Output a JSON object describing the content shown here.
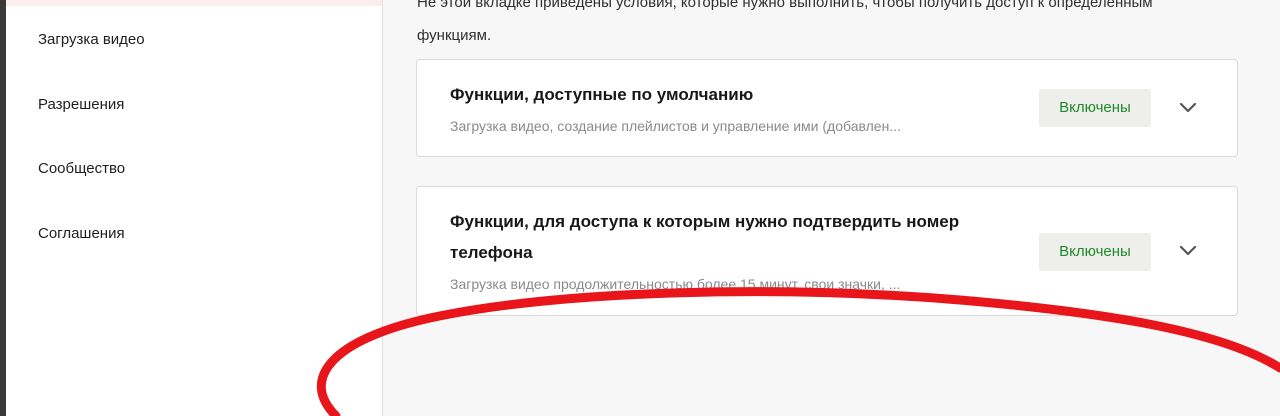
{
  "sidebar": {
    "items": [
      {
        "label": "Загрузка видео"
      },
      {
        "label": "Разрешения"
      },
      {
        "label": "Сообщество"
      },
      {
        "label": "Соглашения"
      }
    ]
  },
  "main": {
    "intro_text": "Не этой вкладке приведены условия, которые нужно выполнить, чтобы получить доступ к определенным функциям.",
    "cards": [
      {
        "title": "Функции, доступные по умолчанию",
        "description": "Загрузка видео, создание плейлистов и управление ими (добавлен...",
        "status": "Включены",
        "toggle_icon": "chevron-down-icon"
      },
      {
        "title": "Функции, для доступа к которым нужно подтвердить номер телефона",
        "description": "Загрузка видео продолжительностью более 15 минут, свои значки, ...",
        "status": "Включены",
        "toggle_icon": "chevron-down-icon"
      }
    ]
  },
  "colors": {
    "status_green": "#1e8a2e",
    "annotation_red": "#e8161b",
    "badge_bg": "#eeeeea"
  }
}
